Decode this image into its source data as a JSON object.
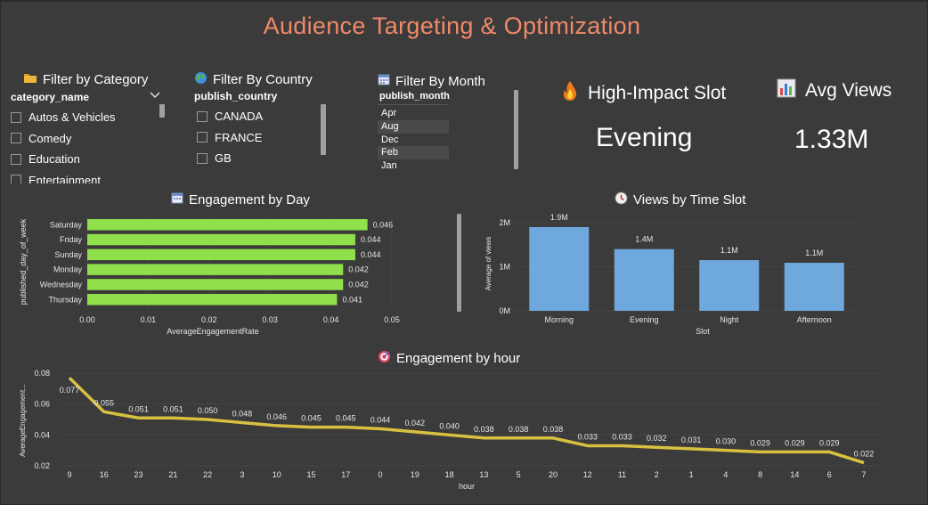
{
  "title": "Audience Targeting & Optimization",
  "colors": {
    "background": "#3b3b3b",
    "title": "#f0896a",
    "engagement_day_bar": "#8fe04a",
    "views_slot_bar": "#6fa8dc",
    "engagement_hour_line": "#d8c040"
  },
  "filters": {
    "category": {
      "title": "Filter by Category",
      "icon": "folder-icon",
      "field": "category_name",
      "items": [
        "Autos & Vehicles",
        "Comedy",
        "Education",
        "Entertainment"
      ]
    },
    "country": {
      "title": "Filter By Country",
      "icon": "globe-icon",
      "field": "publish_country",
      "items": [
        "CANADA",
        "FRANCE",
        "GB"
      ]
    },
    "month": {
      "title": "Filter By Month",
      "icon": "calendar-icon",
      "field": "publish_month",
      "items": [
        "Apr",
        "Aug",
        "Dec",
        "Feb",
        "Jan"
      ],
      "selected": [
        "Aug",
        "Feb"
      ]
    }
  },
  "kpis": {
    "slot": {
      "title": "High-Impact Slot",
      "icon": "fire-icon",
      "value": "Evening"
    },
    "views": {
      "title": "Avg Views",
      "icon": "bar-chart-icon",
      "value": "1.33M"
    }
  },
  "chart_data": [
    {
      "type": "bar",
      "orientation": "horizontal",
      "title": "Engagement by Day",
      "icon": "calendar-icon",
      "categories": [
        "Saturday",
        "Friday",
        "Sunday",
        "Monday",
        "Wednesday",
        "Thursday"
      ],
      "values": [
        0.046,
        0.044,
        0.044,
        0.042,
        0.042,
        0.041
      ],
      "data_labels": [
        "0.046",
        "0.044",
        "0.044",
        "0.042",
        "0.042",
        "0.041"
      ],
      "xlabel": "AverageEngagementRate",
      "ylabel": "published_day_of_week",
      "xlim": [
        0,
        0.05
      ],
      "xticks": [
        "0.00",
        "0.01",
        "0.02",
        "0.03",
        "0.04",
        "0.05"
      ],
      "grid": true
    },
    {
      "type": "bar",
      "title": "Views by Time Slot",
      "icon": "clock-icon",
      "categories": [
        "Morning",
        "Evening",
        "Night",
        "Afternoon"
      ],
      "values": [
        1900000,
        1400000,
        1150000,
        1090000
      ],
      "data_labels": [
        "1.9M",
        "1.4M",
        "1.1M",
        "1.1M"
      ],
      "xlabel": "Slot",
      "ylabel": "Average of views",
      "ylim": [
        0,
        2000000
      ],
      "yticks": [
        "0M",
        "1M",
        "2M"
      ],
      "grid": true
    },
    {
      "type": "line",
      "title": "Engagement by hour",
      "icon": "target-icon",
      "categories": [
        "9",
        "16",
        "23",
        "21",
        "22",
        "3",
        "10",
        "15",
        "17",
        "0",
        "19",
        "18",
        "13",
        "5",
        "20",
        "12",
        "11",
        "2",
        "1",
        "4",
        "8",
        "14",
        "6",
        "7"
      ],
      "values": [
        0.077,
        0.055,
        0.051,
        0.051,
        0.05,
        0.048,
        0.046,
        0.045,
        0.045,
        0.044,
        0.042,
        0.04,
        0.038,
        0.038,
        0.038,
        0.033,
        0.033,
        0.032,
        0.031,
        0.03,
        0.029,
        0.029,
        0.029,
        0.022
      ],
      "data_labels": [
        "0.077",
        "0.055",
        "0.051",
        "0.051",
        "0.050",
        "0.048",
        "0.046",
        "0.045",
        "0.045",
        "0.044",
        "0.042",
        "0.040",
        "0.038",
        "0.038",
        "0.038",
        "0.033",
        "0.033",
        "0.032",
        "0.031",
        "0.030",
        "0.029",
        "0.029",
        "0.029",
        "0.022"
      ],
      "xlabel": "hour",
      "ylabel": "AverageEngagement...",
      "ylim": [
        0.02,
        0.08
      ],
      "yticks": [
        "0.02",
        "0.04",
        "0.06",
        "0.08"
      ],
      "grid": true
    }
  ]
}
